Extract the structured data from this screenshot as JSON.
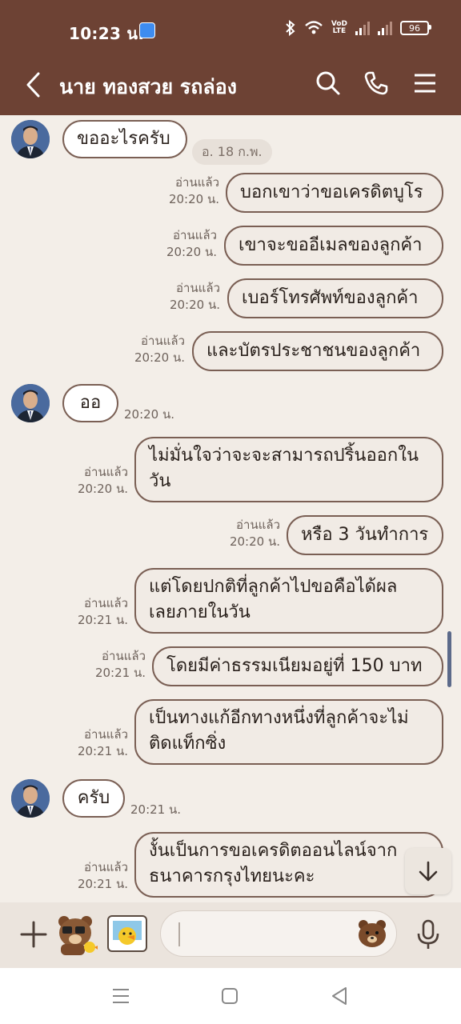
{
  "status_bar": {
    "time": "10:23 น.",
    "battery": "96",
    "volte_top": "VoLTE",
    "volte_label": "VoD LTE"
  },
  "header": {
    "title": "นาย ทองสวย รถล่อง",
    "icons": [
      "back-icon",
      "search-icon",
      "phone-icon",
      "menu-icon"
    ]
  },
  "chat": {
    "date_chip": "อ. 18 ก.พ.",
    "read_label": "อ่านแล้ว",
    "messages": [
      {
        "dir": "in",
        "text": "ขออะไรครับ",
        "time": ""
      },
      {
        "dir": "out",
        "text": "บอกเขาว่าขอเครดิตบูโร",
        "time": "20:20 น."
      },
      {
        "dir": "out",
        "text": "เขาจะขออีเมลของลูกค้า",
        "time": "20:20 น."
      },
      {
        "dir": "out",
        "text": "เบอร์โทรศัพท์ของลูกค้า",
        "time": "20:20 น."
      },
      {
        "dir": "out",
        "text": "และบัตรประชาชนของลูกค้า",
        "time": "20:20 น."
      },
      {
        "dir": "in",
        "text": "ออ",
        "time": "20:20 น."
      },
      {
        "dir": "out",
        "lines": [
          "ไม่มั่นใจว่าจะจะสามารถปริ้นออกใน",
          "วัน"
        ],
        "time": "20:20 น."
      },
      {
        "dir": "out",
        "text": "หรือ 3 วันทำการ",
        "time": "20:20 น."
      },
      {
        "dir": "out",
        "lines": [
          "แต่โดยปกติที่ลูกค้าไปขอคือได้ผล",
          "เลยภายในวัน"
        ],
        "time": "20:21 น."
      },
      {
        "dir": "out",
        "text": "โดยมีค่าธรรมเนียมอยู่ที่ 150 บาท",
        "time": "20:21 น."
      },
      {
        "dir": "out",
        "lines": [
          "เป็นทางแก้อีกทางหนึ่งที่ลูกค้าจะไม่",
          "ติดแท็กซิ่ง"
        ],
        "time": "20:21 น."
      },
      {
        "dir": "in",
        "text": "ครับ",
        "time": "20:21 น."
      },
      {
        "dir": "out",
        "lines": [
          "งั้นเป็นการขอเครดิตออนไลน์จาก",
          "ธนาคารกรุงไทยนะคะ"
        ],
        "time": "20:21 น."
      }
    ]
  },
  "input": {
    "value": "",
    "placeholder": "",
    "icons": [
      "plus-icon",
      "brown-sticker-icon",
      "sally-sticker-icon",
      "emoji-icon",
      "mic-icon"
    ]
  },
  "colors": {
    "header_bg": "#6d4234",
    "chat_bg": "#f3eee8",
    "bubble_border": "#7a5f54"
  }
}
